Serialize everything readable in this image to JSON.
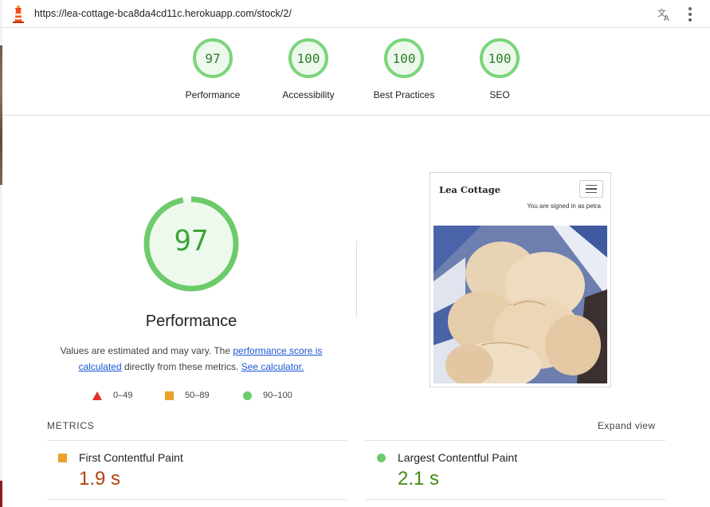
{
  "browser": {
    "url": "https://lea-cottage-bca8da4cd11c.herokuapp.com/stock/2/"
  },
  "scores": [
    {
      "value": "97",
      "label": "Performance"
    },
    {
      "value": "100",
      "label": "Accessibility"
    },
    {
      "value": "100",
      "label": "Best Practices"
    },
    {
      "value": "100",
      "label": "SEO"
    }
  ],
  "main": {
    "score": "97",
    "score_fraction": 0.97,
    "title": "Performance",
    "desc_prefix": "Values are estimated and may vary. The ",
    "link_score": "performance score is calculated",
    "desc_middle": " directly from these metrics. ",
    "link_calculator": "See calculator."
  },
  "legend": [
    {
      "shape": "triangle",
      "text": "0–49",
      "color": "#e3312a"
    },
    {
      "shape": "square",
      "text": "50–89",
      "color": "#eba12b"
    },
    {
      "shape": "circle",
      "text": "90–100",
      "color": "#6ccb6a"
    }
  ],
  "screenshot": {
    "brand": "Lea Cottage",
    "signed_in": "You are signed in as petra"
  },
  "metrics": {
    "title": "METRICS",
    "expand": "Expand view",
    "items": [
      {
        "label": "First Contentful Paint",
        "value": "1.9 s",
        "status": "average",
        "color": "#b4410b"
      },
      {
        "label": "Largest Contentful Paint",
        "value": "2.1 s",
        "status": "pass",
        "color": "#418a15"
      }
    ]
  },
  "colors": {
    "pass": "#6ccb6a",
    "pass_text": "#3da43a",
    "average": "#eba12b",
    "fail": "#e3312a",
    "link": "#1a57d6"
  }
}
